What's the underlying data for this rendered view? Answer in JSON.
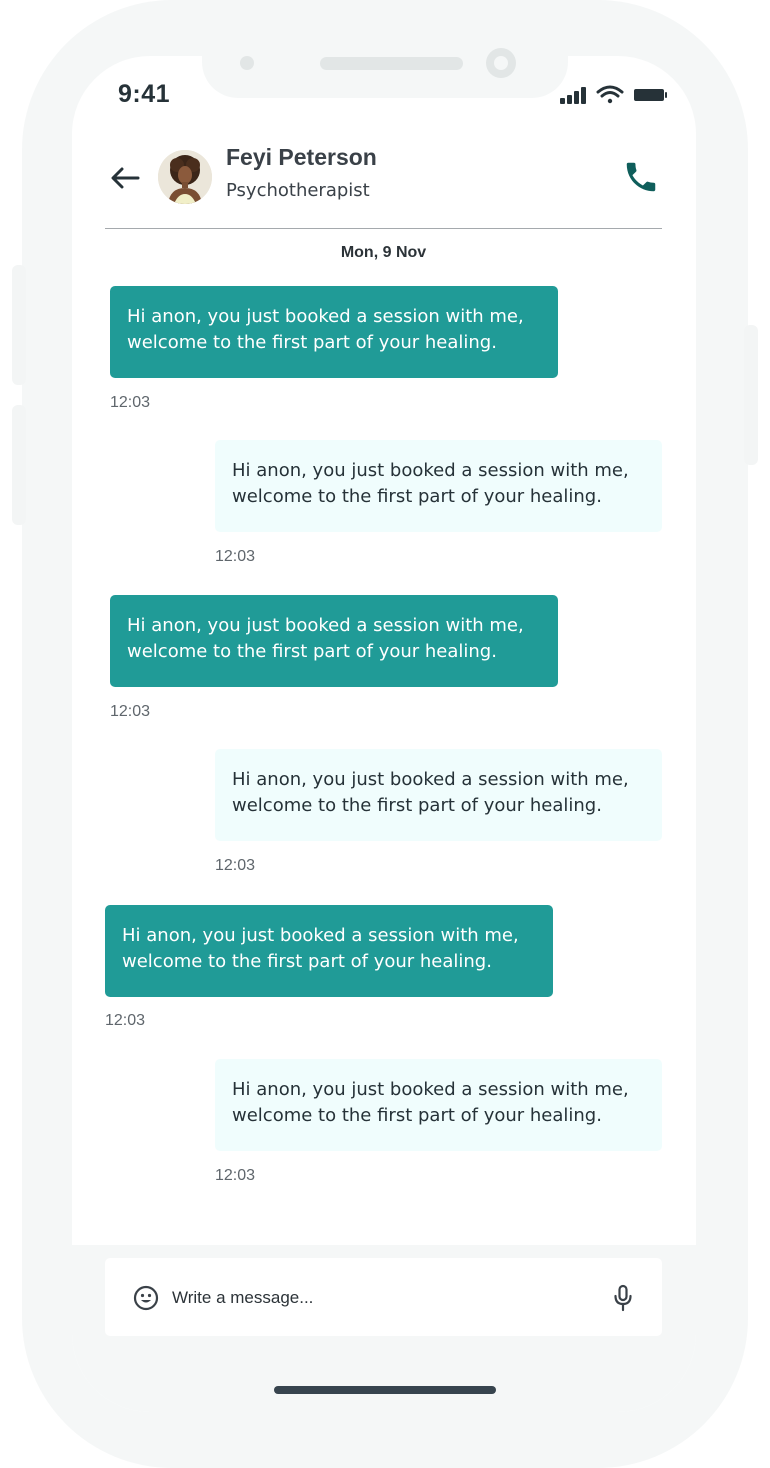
{
  "status_bar": {
    "time": "9:41"
  },
  "header": {
    "contact_name": "Feyi Peterson",
    "contact_role": "Psychotherapist"
  },
  "chat": {
    "date_label": "Mon, 9 Nov",
    "messages": [
      {
        "direction": "incoming",
        "text": "Hi anon, you just booked a session with me,\nwelcome to the first part of your healing.",
        "time": "12:03"
      },
      {
        "direction": "outgoing",
        "text": "Hi anon, you just booked a session with me,\nwelcome to the first part of your healing.",
        "time": "12:03"
      },
      {
        "direction": "incoming",
        "text": "Hi anon, you just booked a session with me,\nwelcome to the first part of your healing.",
        "time": "12:03"
      },
      {
        "direction": "outgoing",
        "text": "Hi anon, you just booked a session with me,\nwelcome to the first part of your healing.",
        "time": "12:03"
      },
      {
        "direction": "incoming",
        "text": "Hi anon, you just booked a session with me,\nwelcome to the first part of your healing.",
        "time": "12:03"
      },
      {
        "direction": "outgoing",
        "text": "Hi anon, you just booked a session with me,\nwelcome to the first part of your healing.",
        "time": "12:03"
      }
    ]
  },
  "composer": {
    "placeholder": "Write a message..."
  },
  "icons": {
    "back": "arrow-left-icon",
    "call": "phone-icon",
    "emoji": "smiley-icon",
    "mic": "microphone-icon",
    "signal": "cellular-signal-icon",
    "wifi": "wifi-icon",
    "battery": "battery-icon"
  },
  "colors": {
    "incoming_bubble": "#209b97",
    "outgoing_bubble": "#f0fdfd",
    "accent_icon": "#0f5e5b",
    "text_dark": "#263238"
  }
}
